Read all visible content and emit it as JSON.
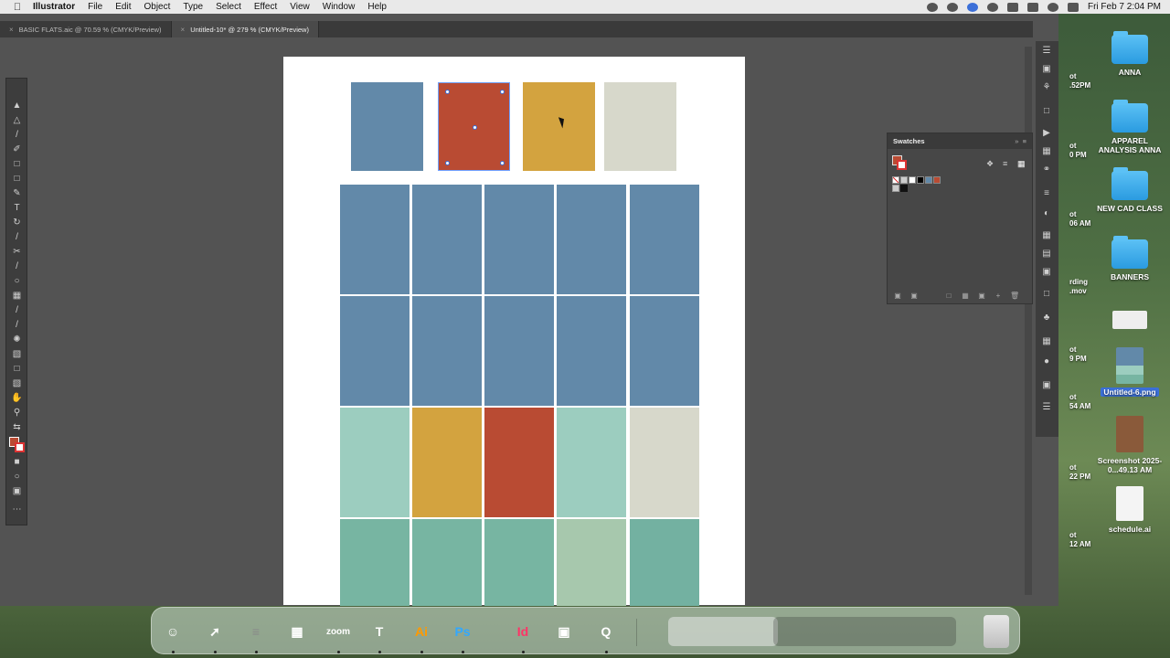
{
  "menubar": {
    "app_name": "Illustrator",
    "items": [
      "File",
      "Edit",
      "Object",
      "Type",
      "Select",
      "Effect",
      "View",
      "Window",
      "Help"
    ],
    "clock": "Fri Feb 7  2:04 PM"
  },
  "tabs": [
    {
      "label": "BASIC FLATS.aic @ 70.59 % (CMYK/Preview)",
      "active": false
    },
    {
      "label": "Untitled-10* @ 279 % (CMYK/Preview)",
      "active": true
    }
  ],
  "swatches_panel": {
    "title": "Swatches",
    "colors": [
      "#ffffff",
      "#000000",
      "#6289a9",
      "#b94b33"
    ]
  },
  "colors": {
    "blue": "#6289a9",
    "red": "#b94b33",
    "gold": "#d3a33f",
    "light_gray": "#d7d8cb",
    "mint": "#9ccdbf",
    "sage": "#a7c8ad",
    "teal": "#77b5a2",
    "teal2": "#73b1a1"
  },
  "canvas": {
    "top_row": [
      "blue",
      "red",
      "gold",
      "light_gray"
    ],
    "grid": [
      [
        "blue",
        "blue",
        "blue",
        "blue",
        "blue"
      ],
      [
        "blue",
        "blue",
        "blue",
        "blue",
        "blue"
      ],
      [
        "mint",
        "gold",
        "red",
        "mint",
        "light_gray"
      ],
      [
        "teal",
        "teal",
        "teal",
        "sage",
        "teal2"
      ]
    ],
    "selected_top_index": 1
  },
  "desktop": {
    "items": [
      {
        "label": "ANNA",
        "type": "folder"
      },
      {
        "label": "APPAREL ANALYSIS ANNA",
        "type": "folder"
      },
      {
        "label": "NEW CAD CLASS",
        "type": "folder"
      },
      {
        "label": "BANNERS",
        "type": "folder"
      },
      {
        "label": "",
        "type": "image"
      },
      {
        "label": "Untitled-6.png",
        "type": "image"
      },
      {
        "label": "Screenshot 2025-0...49.13 AM",
        "type": "image"
      },
      {
        "label": "schedule.ai",
        "type": "document"
      }
    ],
    "partial_labels": [
      "ot",
      ".52PM",
      "ot",
      "0 PM",
      "ot",
      "06 AM",
      "rding",
      ".mov",
      "ot",
      "9 PM",
      "ot",
      "54 AM",
      "ot",
      "22 PM",
      "ot",
      "12 AM"
    ]
  },
  "dock": {
    "apps": [
      {
        "name": "Finder",
        "label": "",
        "color": "#2a7de1"
      },
      {
        "name": "Safari",
        "label": "",
        "color": "#1f8df0"
      },
      {
        "name": "Reminders",
        "label": "",
        "color": "#f2f2f2"
      },
      {
        "name": "Calculator",
        "label": "",
        "color": "#333333"
      },
      {
        "name": "Zoom",
        "label": "zoom",
        "color": "#2d8cff"
      },
      {
        "name": "Teams",
        "label": "",
        "color": "#5b5fc7"
      },
      {
        "name": "Illustrator",
        "label": "Ai",
        "color": "#330000"
      },
      {
        "name": "Photoshop",
        "label": "Ps",
        "color": "#001e36"
      },
      {
        "name": "InDesign",
        "label": "Id",
        "color": "#49021f"
      },
      {
        "name": "Preview",
        "label": "",
        "color": "#8aa7c7"
      },
      {
        "name": "QuickTime",
        "label": "",
        "color": "#1c1c1c"
      }
    ]
  }
}
